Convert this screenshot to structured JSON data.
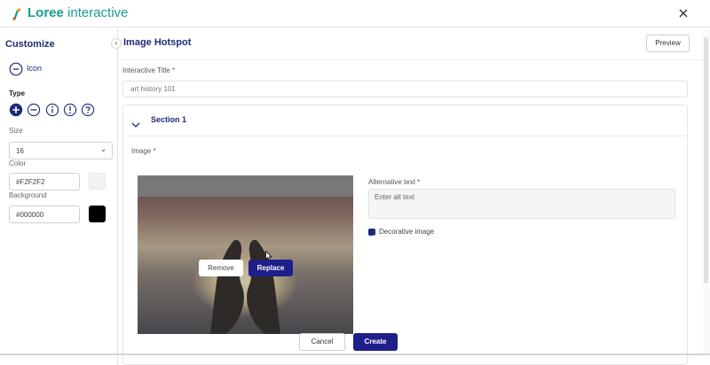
{
  "app": {
    "brand_bold": "Loree",
    "brand_light": " interactive",
    "logo_icon": "loree-logo-icon",
    "close_icon": "close-icon"
  },
  "sidebar": {
    "title": "Customize",
    "collapse_glyph": "‹",
    "icon_toggle_label": "Icon",
    "type_label": "Type",
    "type_icons": [
      "plus-circle-icon",
      "minus-circle-icon",
      "info-circle-icon",
      "exclamation-circle-icon",
      "question-circle-icon"
    ],
    "size_label": "Size",
    "size_value": "16",
    "size_chevron": "⌄",
    "color_label": "Color",
    "color_value": "#F2F2F2",
    "background_label": "Background",
    "background_value": "#000000"
  },
  "main": {
    "title": "Image Hotspot",
    "preview_label": "Preview",
    "interactive_title_label": "Interactive Title *",
    "interactive_title_value": "art history 101",
    "section": {
      "title": "Section 1",
      "image_label": "Image *",
      "remove_label": "Remove",
      "replace_label": "Replace",
      "alt_text_label": "Alternative text *",
      "alt_text_placeholder": "Enter alt text",
      "decorative_label": "Decorative image",
      "decorative_checked": true
    }
  },
  "footer": {
    "cancel_label": "Cancel",
    "create_label": "Create"
  },
  "colors": {
    "brand_teal": "#1d9a91",
    "accent_navy": "#1f1f8a",
    "heading_blue": "#1e2a78",
    "swatch_color": "#F2F2F2",
    "swatch_background": "#000000"
  }
}
